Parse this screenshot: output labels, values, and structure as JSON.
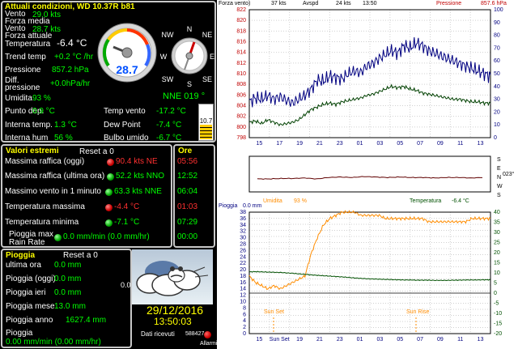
{
  "current": {
    "title": "Attuali condizioni, WD 10.37R b81",
    "vento_label": "Vento",
    "vento_media_label": "Forza media",
    "vento_media_value": "29.0 kts",
    "vento_attuale_label1": "Vento",
    "vento_attuale_label2": "Forza attuale",
    "vento_attuale_value": "28.7 kts",
    "temp_label": "Temperatura",
    "temp_value": "-6.4 °C",
    "trend_label": "Trend temp",
    "trend_value": "+0.2 °C /hr",
    "press_label": "Pressione",
    "press_value": "857.2 hPa",
    "diffpress_label1": "Diff.",
    "diffpress_label2": "pressione",
    "diffpress_value": "+0.0hPa/hr",
    "umid_label": "Umidita",
    "umid_value": "93 %",
    "dew_label": "Punto dep.",
    "dew_value": "0.9 °C",
    "int_temp_label": "Interna temp.",
    "int_temp_value": "1.3 °C",
    "int_hum_label": "Interna hum",
    "int_hum_value": "56 %",
    "tempvento_label": "Temp vento",
    "tempvento_value": "-17.2 °C",
    "dewpoint_label": "Dew Point",
    "dewpoint_value": "-7.4 °C",
    "bulbo_label": "Bulbo umido",
    "bulbo_value": "-6.7 °C",
    "gauge_value": "28.7",
    "dir_value": "NNE 019 °",
    "bar_value": "10.7",
    "compass": {
      "n": "N",
      "ne": "NE",
      "e": "E",
      "se": "SE",
      "s": "S",
      "sw": "SW",
      "w": "W",
      "nw": "NW"
    }
  },
  "extremes": {
    "title": "Valori estremi",
    "reset": "Reset a 0",
    "ore_title": "Ore",
    "rows": [
      {
        "label": "Massima raffica (oggi)",
        "value": "90.4 kts  NE",
        "time": "05:56"
      },
      {
        "label": "Massima raffica (ultima ora)",
        "value": "52.2 kts NNO",
        "time": "12:52"
      },
      {
        "label": "Massimo vento in 1 minuto",
        "value": "63.3 kts NNE",
        "time": "06:04"
      },
      {
        "label": "Temperatura massima",
        "value": "-4.4 °C",
        "time": "01:03"
      },
      {
        "label": "Temperatura minima",
        "value": "-7.1 °C",
        "time": "07:29"
      },
      {
        "label": "Pioggia max",
        "label2": "Rain Rate",
        "value": "0.0 mm/min (0.0 mm/hr)",
        "time": "00:00"
      }
    ]
  },
  "rain": {
    "title": "Pioggia",
    "reset": "Reset a 0",
    "rows": [
      {
        "label": "ultima ora",
        "value": "0.0 mm"
      },
      {
        "label": "Pioggia (oggi)",
        "value": "0.0 mm"
      },
      {
        "label": "Pioggia ieri",
        "value": "0.0 mm"
      },
      {
        "label": "Pioggia mese",
        "value": "13.0 mm"
      },
      {
        "label": "Pioggia anno",
        "value": "1627.4 mm"
      }
    ],
    "rate_label": "Pioggia",
    "rate_value": "0.00 mm/min (0.00 mm/hr)",
    "side_value": "0.0"
  },
  "status": {
    "date": "29/12/2016",
    "time": "13:50:03",
    "dati_label": "Dati ricevuti",
    "dati_value": "588427",
    "allarmi": "Allarmi"
  },
  "chart_data": [
    {
      "type": "line",
      "header": {
        "forza": "Forza vento)",
        "kts": "37 kts",
        "avspd": "Avspd",
        "avspd_val": "24 kts",
        "time": "13:50",
        "press_label": "Pressione",
        "press_val": "857.6 hPa"
      },
      "x_ticks": [
        "15",
        "17",
        "19",
        "21",
        "23",
        "01",
        "03",
        "05",
        "07",
        "09",
        "11",
        "13"
      ],
      "y_left_ticks": [
        "798",
        "800",
        "802",
        "804",
        "806",
        "808",
        "810",
        "812",
        "814",
        "816",
        "818",
        "820",
        "822"
      ],
      "y_right_ticks": [
        "0",
        "10",
        "20",
        "30",
        "40",
        "50",
        "60",
        "70",
        "80",
        "90",
        "100"
      ],
      "ylim_right": [
        0,
        100
      ],
      "series": [
        {
          "name": "gust",
          "color": "#000080",
          "values": [
            28,
            31,
            30,
            33,
            30,
            32,
            29,
            27,
            30,
            33,
            38,
            45,
            44,
            48,
            47,
            46,
            50,
            52,
            51,
            56,
            58,
            62,
            65,
            68,
            66,
            72,
            70,
            74,
            72,
            68,
            66,
            64,
            62,
            60,
            58,
            56,
            54,
            52,
            50,
            48
          ]
        },
        {
          "name": "avg",
          "color": "#004000",
          "values": [
            12,
            13,
            11,
            14,
            12,
            10,
            11,
            12,
            14,
            18,
            22,
            24,
            26,
            27,
            26,
            28,
            29,
            30,
            31,
            33,
            34,
            36,
            38,
            40,
            39,
            40,
            38,
            37,
            35,
            34,
            33,
            32,
            31,
            30,
            30,
            29,
            28,
            28,
            27,
            27
          ]
        }
      ]
    },
    {
      "type": "line",
      "side_letters": [
        "S",
        "E",
        "N",
        "W",
        "S"
      ],
      "side_value": "023°",
      "series": [
        {
          "name": "direction",
          "color": "#600000",
          "values": [
            20,
            20,
            21,
            21,
            22,
            20,
            23,
            24,
            23,
            25,
            24,
            23,
            24,
            23,
            23,
            22,
            23,
            23,
            22,
            23
          ]
        }
      ]
    },
    {
      "type": "line",
      "header": {
        "pioggia": "Pioggia",
        "pioggia_val": "0.0 mm",
        "umid": "Umidita",
        "umid_val": "93 %",
        "temp": "Temperatura",
        "temp_val": "-6.4 °C"
      },
      "x_ticks": [
        "15",
        "Sun Set",
        "19",
        "21",
        "23",
        "01",
        "03",
        "05",
        "07",
        "09",
        "11",
        "13"
      ],
      "y_left_ticks": [
        "0",
        "2",
        "4",
        "6",
        "8",
        "10",
        "12",
        "14",
        "16",
        "18",
        "20",
        "22",
        "24",
        "26",
        "28",
        "30",
        "32",
        "34",
        "36",
        "38",
        "40"
      ],
      "y_right_ticks": [
        "-20",
        "-15",
        "-10",
        "-5",
        "0",
        "5",
        "10",
        "15",
        "20",
        "25",
        "30",
        "35",
        "40"
      ],
      "annotations": [
        "Sun Set",
        "Sun Rise"
      ],
      "series": [
        {
          "name": "humidity",
          "color": "#ff8c00",
          "values": [
            18,
            16,
            15,
            14,
            15,
            14,
            15,
            16,
            17,
            18,
            25,
            30,
            34,
            36,
            37,
            38,
            38,
            38,
            37,
            37,
            37,
            37,
            36,
            36,
            36,
            36,
            36,
            36,
            36,
            35,
            35,
            35,
            35,
            35,
            35,
            35,
            36,
            36,
            36,
            36
          ]
        },
        {
          "name": "temperature",
          "color": "#005000",
          "values": [
            10.5,
            10.6,
            10.5,
            10.4,
            10.3,
            10.2,
            10.0,
            9.8,
            9.5,
            9.3,
            9.0,
            8.8,
            8.6,
            8.4,
            8.2,
            8.0,
            7.8,
            7.5,
            7.3,
            7.1,
            7.0,
            6.9,
            6.8,
            6.7,
            6.6,
            6.5,
            6.5,
            6.4,
            6.4,
            6.4,
            6.3,
            6.3,
            6.3,
            6.4,
            6.4,
            6.5,
            6.5,
            6.5,
            6.6,
            6.6
          ]
        }
      ]
    }
  ]
}
